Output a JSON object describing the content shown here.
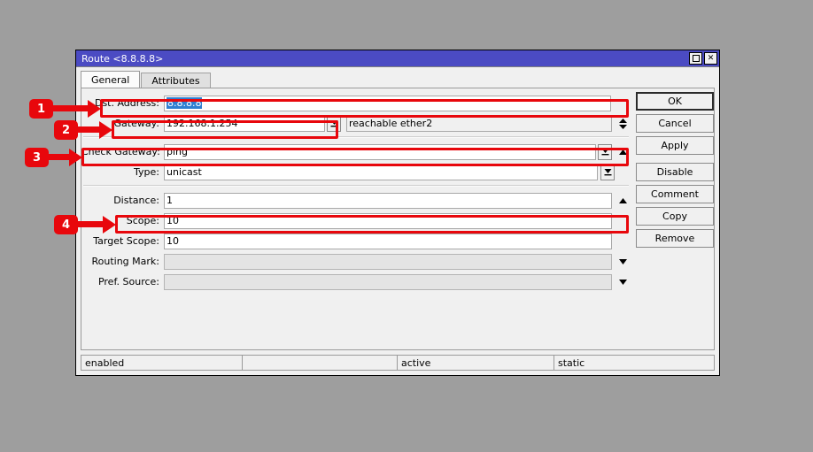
{
  "window": {
    "title": "Route <8.8.8.8>",
    "buttons": {
      "maximize": "maximize-icon",
      "close": "✕"
    }
  },
  "tabs": [
    {
      "label": "General",
      "active": true
    },
    {
      "label": "Attributes",
      "active": false
    }
  ],
  "form": {
    "rows": [
      {
        "label": "Dst. Address:",
        "value": "8.8.8.8",
        "selected": true
      },
      {
        "label": "Gateway:",
        "value": "192.168.1.254",
        "value2": "reachable ether2"
      },
      {
        "label": "Check Gateway:",
        "value": "ping"
      },
      {
        "label": "Type:",
        "value": "unicast"
      },
      {
        "label": "Distance:",
        "value": "1"
      },
      {
        "label": "Scope:",
        "value": "10"
      },
      {
        "label": "Target Scope:",
        "value": "10"
      },
      {
        "label": "Routing Mark:",
        "value": ""
      },
      {
        "label": "Pref. Source:",
        "value": ""
      }
    ]
  },
  "buttons": [
    {
      "label": "OK"
    },
    {
      "label": "Cancel"
    },
    {
      "label": "Apply"
    },
    {
      "label": "Disable"
    },
    {
      "label": "Comment"
    },
    {
      "label": "Copy"
    },
    {
      "label": "Remove"
    }
  ],
  "statusbar": [
    {
      "text": "enabled"
    },
    {
      "text": ""
    },
    {
      "text": "active"
    },
    {
      "text": "static"
    }
  ],
  "annotations": [
    {
      "number": "1",
      "target": "dst-address-row"
    },
    {
      "number": "2",
      "target": "gateway-row"
    },
    {
      "number": "3",
      "target": "check-gateway-row"
    },
    {
      "number": "4",
      "target": "scope-row"
    }
  ],
  "colors": {
    "titlebar": "#4b4bc3",
    "annotation": "#e8070c",
    "selection": "#2f7fd1",
    "desktop": "#9e9e9e"
  }
}
